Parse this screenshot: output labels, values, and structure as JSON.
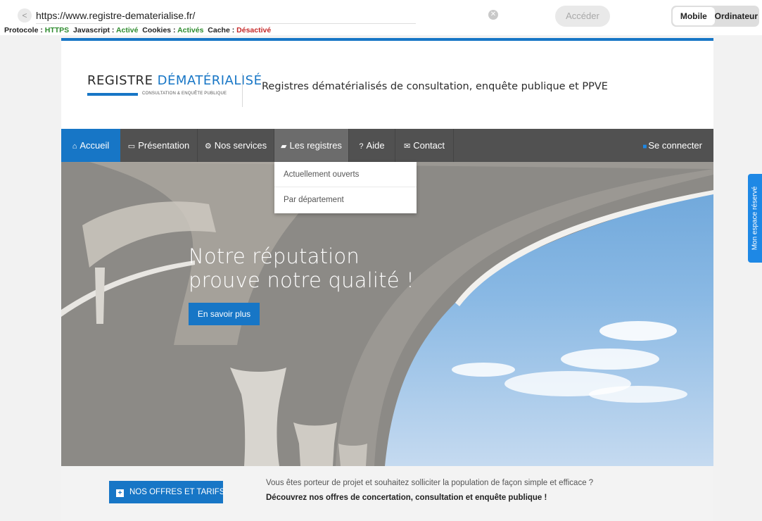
{
  "browser": {
    "url": "https://www.registre-dematerialise.fr/",
    "go_label": "Accéder",
    "modes": [
      "Mobile",
      "Ordinateur"
    ],
    "status": {
      "protocol_label": "Protocole :",
      "protocol_value": "HTTPS",
      "javascript_label": "Javascript :",
      "javascript_value": "Activé",
      "cookies_label": "Cookies :",
      "cookies_value": "Activés",
      "cache_label": "Cache :",
      "cache_value": "Désactivé"
    }
  },
  "header": {
    "logo_main": "REGISTRE ",
    "logo_accent": "DÉMATÉRIALISÉ",
    "logo_sub": "CONSULTATION & ENQUÊTE PUBLIQUE",
    "title": "Registres dématérialisés de consultation, enquête publique et PPVE"
  },
  "nav": {
    "items": [
      {
        "label": "Accueil",
        "icon": "home-icon"
      },
      {
        "label": "Présentation",
        "icon": "monitor-icon"
      },
      {
        "label": "Nos services",
        "icon": "cogs-icon"
      },
      {
        "label": "Les registres",
        "icon": "book-icon"
      },
      {
        "label": "Aide",
        "icon": "question-icon"
      },
      {
        "label": "Contact",
        "icon": "envelope-icon"
      }
    ],
    "login": "Se connecter",
    "dropdown": [
      "Actuellement ouverts",
      "Par département"
    ]
  },
  "hero": {
    "line1": "Notre réputation",
    "line2": "prouve notre qualité !",
    "cta": "En savoir plus"
  },
  "band": {
    "button": "NOS OFFRES ET TARIFS",
    "text1": "Vous êtes porteur de projet et souhaitez solliciter la population de façon simple et efficace ?",
    "text2": "Découvrez nos offres de concertation, consultation et enquête publique !"
  },
  "side_tab": "Mon espace réservé",
  "colors": {
    "accent": "#1776c6",
    "navbar": "#515151",
    "side_tab": "#1e88e5"
  }
}
